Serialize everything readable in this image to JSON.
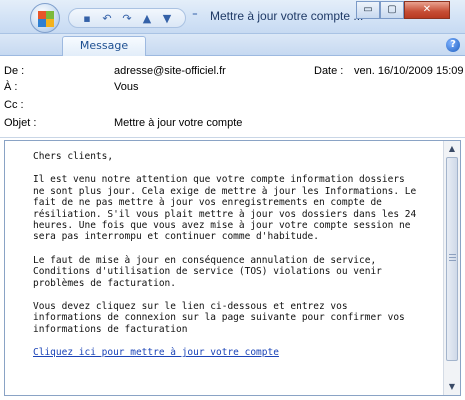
{
  "window": {
    "title": "Mettre à jour votre compte ...",
    "minimize_icon": "minimize-icon",
    "maximize_icon": "maximize-icon",
    "close_icon": "close-icon",
    "min_glyph": "▭",
    "max_glyph": "▢",
    "close_glyph": "✕"
  },
  "quick_access": {
    "save_glyph": "▪",
    "undo_glyph": "↶",
    "redo_glyph": "↷",
    "up_glyph": "▲",
    "down_glyph": "▼",
    "more_glyph": "⁼"
  },
  "ribbon": {
    "tab_label": "Message",
    "help_glyph": "?"
  },
  "header": {
    "from_label": "De :",
    "from_value": "adresse@site-officiel.fr",
    "to_label": "À :",
    "to_value": "Vous",
    "cc_label": "Cc :",
    "cc_value": "",
    "subject_label": "Objet :",
    "subject_value": "Mettre à jour votre compte",
    "date_label": "Date :",
    "date_value": "ven. 16/10/2009 15:09"
  },
  "message": {
    "greeting": "Chers clients,",
    "para1": "Il est venu notre attention que votre compte information dossiers\nne sont plus jour. Cela exige de mettre à jour les Informations. Le\nfait de ne pas mettre à jour vos enregistrements en compte de\nrésiliation. S'il vous plait mettre à jour vos dossiers dans les 24\nheures. Une fois que vous avez mise à jour votre compte session ne\nsera pas interrompu et continuer comme d'habitude.",
    "para2": "Le faut de mise à jour en conséquence annulation de service,\nConditions d'utilisation de service (TOS) violations ou venir\nproblèmes de facturation.",
    "para3": "Vous devez cliquez sur le lien ci-dessous et entrez vos\ninformations de connexion sur la page suivante pour confirmer vos\ninformations de facturation",
    "link": "Cliquez ici pour mettre à jour votre compte"
  },
  "scroll": {
    "up_glyph": "▲",
    "down_glyph": "▼"
  },
  "colors": {
    "accent": "#1d4f91",
    "link": "#1a43b7",
    "close_button": "#c64d34"
  }
}
